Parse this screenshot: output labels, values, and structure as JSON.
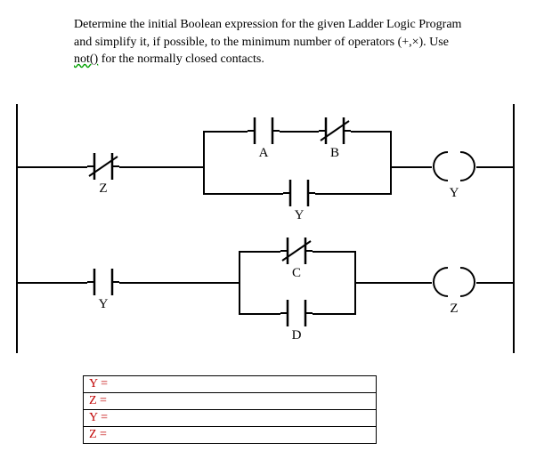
{
  "problem": {
    "line1": "Determine the initial Boolean expression for the given Ladder Logic Program",
    "line2_a": "and simplify it, if possible, to the minimum number of operators (+,×). Use",
    "line2_b_u": "not()",
    "line2_c": " for the normally closed contacts."
  },
  "ladder": {
    "rung1": {
      "input1": {
        "label": "Z",
        "type": "NC"
      },
      "branch_top": {
        "c1": {
          "label": "A",
          "type": "NO"
        },
        "c2": {
          "label": "B",
          "type": "NC"
        }
      },
      "branch_bot": {
        "c1": {
          "label": "Y",
          "type": "NO"
        }
      },
      "output": {
        "label": "Y"
      }
    },
    "rung2": {
      "input1": {
        "label": "Y",
        "type": "NO"
      },
      "branch_top": {
        "c1": {
          "label": "C",
          "type": "NC"
        }
      },
      "branch_bot": {
        "c1": {
          "label": "D",
          "type": "NO"
        }
      },
      "output": {
        "label": "Z"
      }
    }
  },
  "answers": {
    "row1": "Y =",
    "row2": "Z =",
    "row3": "Y =",
    "row4": "Z ="
  }
}
